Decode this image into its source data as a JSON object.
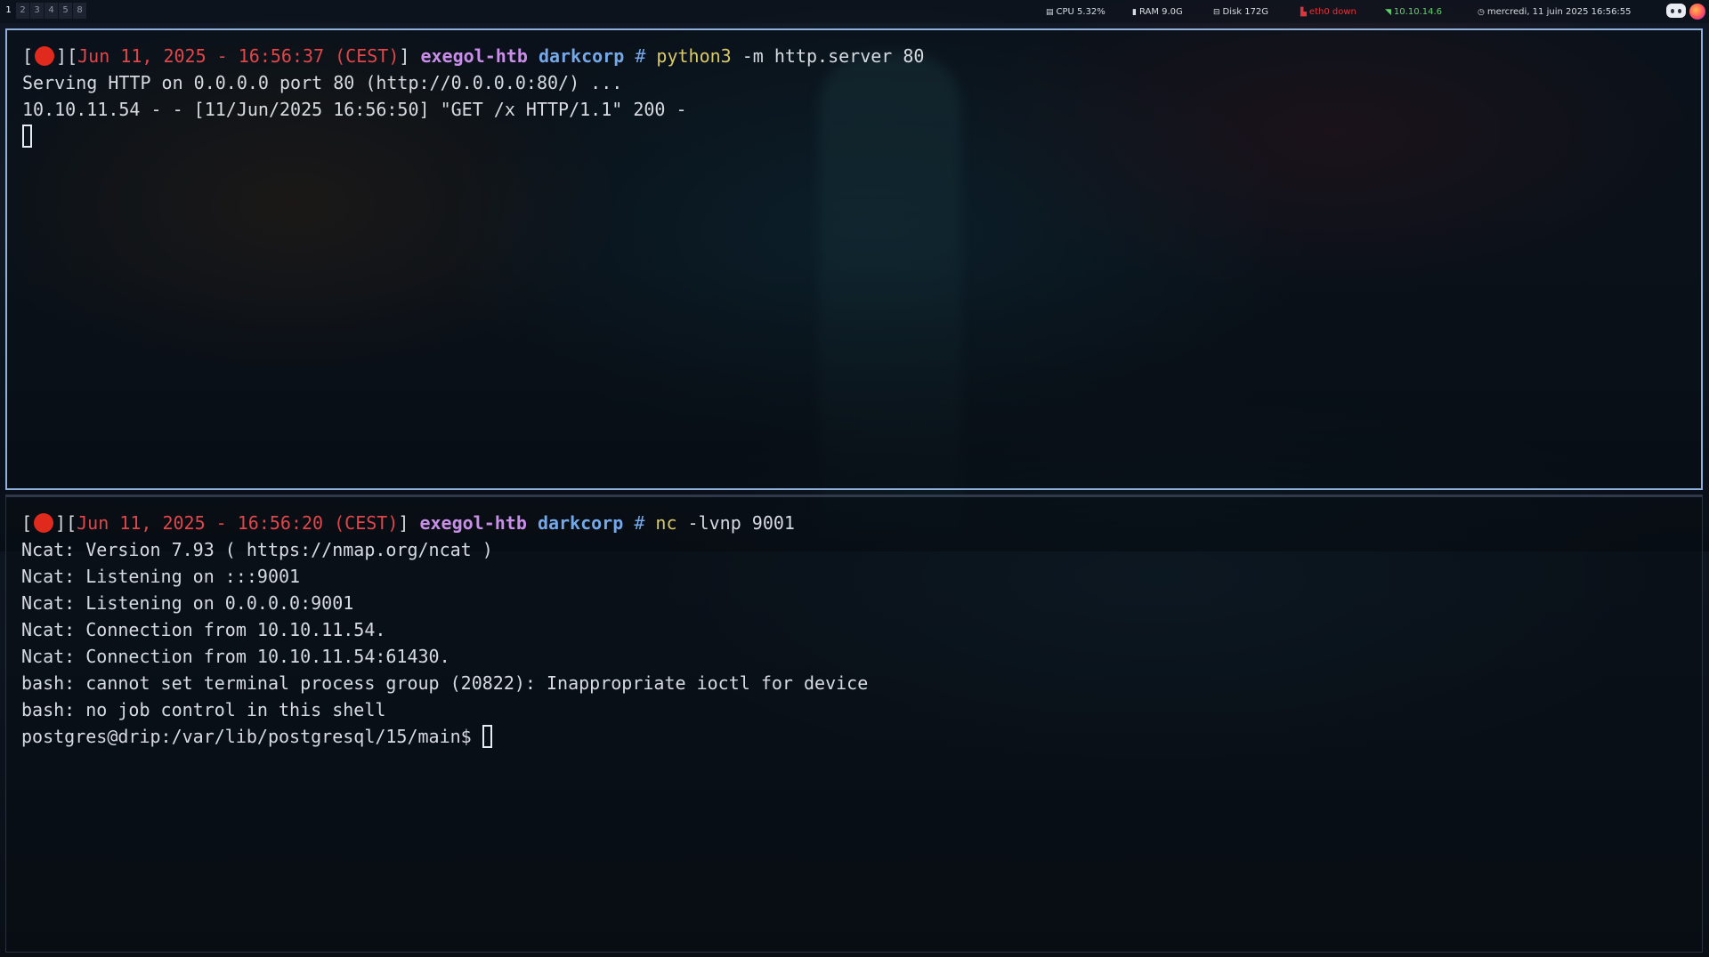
{
  "topbar": {
    "workspaces": [
      "1",
      "2",
      "3",
      "4",
      "5",
      "8"
    ],
    "active_workspace": "1",
    "cpu": "CPU 5.32%",
    "ram": "RAM 9.0G",
    "disk": "Disk 172G",
    "eth": "eth0 down",
    "ip": "10.10.14.6",
    "clock": "mercredi, 11 juin 2025 16:56:55",
    "icons": [
      "cpu-icon",
      "ram-icon",
      "disk-icon",
      "network-down-icon",
      "vpn-icon",
      "clock-icon",
      "discord-icon",
      "firefox-icon"
    ]
  },
  "panes": {
    "top": {
      "prompt": {
        "open": "[",
        "mid": "][",
        "date": "Jun 11, 2025 - 16:56:37 (CEST)",
        "close": "]",
        "host": "exegol-htb",
        "project": "darkcorp",
        "hash": "#",
        "cmd": "python3",
        "args": "-m http.server 80"
      },
      "output": [
        "Serving HTTP on 0.0.0.0 port 80 (http://0.0.0.0:80/) ...",
        "10.10.11.54 - - [11/Jun/2025 16:56:50] \"GET /x HTTP/1.1\" 200 -"
      ]
    },
    "bottom": {
      "prompt": {
        "open": "[",
        "mid": "][",
        "date": "Jun 11, 2025 - 16:56:20 (CEST)",
        "close": "]",
        "host": "exegol-htb",
        "project": "darkcorp",
        "hash": "#",
        "cmd": "nc",
        "args": "-lvnp 9001"
      },
      "output": [
        "Ncat: Version 7.93 ( https://nmap.org/ncat )",
        "Ncat: Listening on :::9001",
        "Ncat: Listening on 0.0.0.0:9001",
        "Ncat: Connection from 10.10.11.54.",
        "Ncat: Connection from 10.10.11.54:61430.",
        "bash: cannot set terminal process group (20822): Inappropriate ioctl for device",
        "bash: no job control in this shell"
      ],
      "shell_prompt": "postgres@drip:/var/lib/postgresql/15/main$ "
    }
  },
  "colors": {
    "record_dot": "#e02a1e",
    "date": "#e0464a",
    "host": "#c98ee8",
    "project": "#74a8e8",
    "command": "#d8c96a",
    "active_border": "#8fb0d8"
  }
}
